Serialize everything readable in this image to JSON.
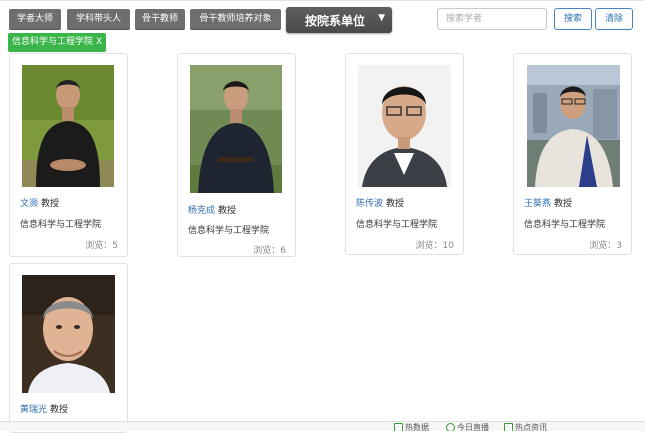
{
  "categories": [
    {
      "label": "学者大师"
    },
    {
      "label": "学科带头人"
    },
    {
      "label": "骨干教师"
    },
    {
      "label": "骨干教师培养对象"
    }
  ],
  "dept_filter": {
    "label": "按院系单位",
    "icon": "caret-down-icon"
  },
  "search": {
    "placeholder": "搜索学者",
    "button": "搜索",
    "clear": "清除"
  },
  "active_filter": {
    "label": "信息科学与工程学院",
    "remove": "X"
  },
  "scholars": [
    {
      "name": "文濒",
      "title": "教授",
      "school": "信息科学与工程学院",
      "views": "浏览：5"
    },
    {
      "name": "杨克成",
      "title": "教授",
      "school": "信息科学与工程学院",
      "views": "浏览：6"
    },
    {
      "name": "陈传波",
      "title": "教授",
      "school": "信息科学与工程学院",
      "views": "浏览：10"
    },
    {
      "name": "王葵燕",
      "title": "教授",
      "school": "信息科学与工程学院",
      "views": "浏览：3"
    },
    {
      "name": "黄瑞光",
      "title": "教授",
      "school": "",
      "views": ""
    }
  ],
  "statusbar": {
    "item1": "热数据",
    "item2": "今日直播",
    "item3": "热点资讯"
  },
  "colors": {
    "accent": "#2f6fb3",
    "tag": "#39b54a",
    "category_btn": "#6e6e6e"
  }
}
